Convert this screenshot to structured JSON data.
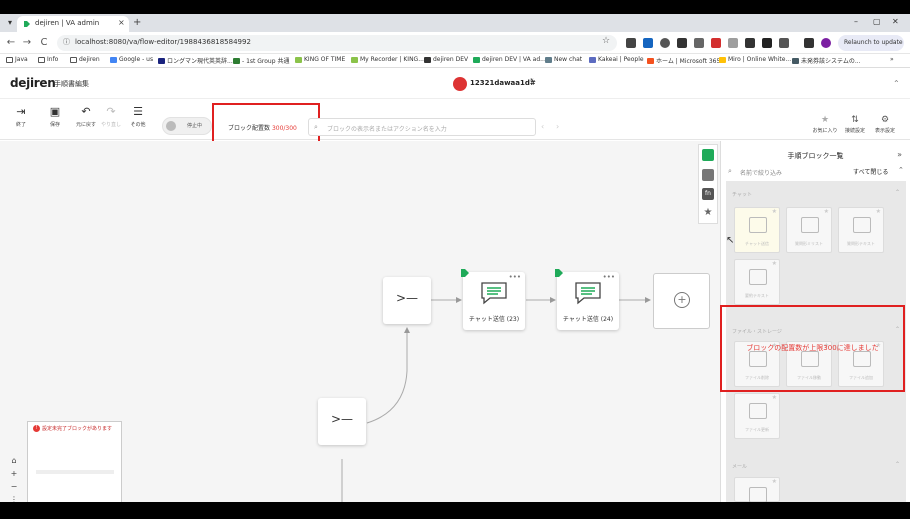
{
  "browser": {
    "tab": {
      "title": "dejiren | VA admin",
      "close": "×"
    },
    "new_tab": "+",
    "window_controls": [
      "–",
      "▢",
      "✕"
    ],
    "nav": {
      "back": "←",
      "forward": "→",
      "reload": "C"
    },
    "url": "localhost:8080/va/flow-editor/1988436818584992",
    "relaunch": "Relaunch to update",
    "bookmarks": [
      "Java",
      "Info",
      "dejiren",
      "Google - us",
      "ロングマン現代英英辞...",
      "- 1st Group 共通",
      "KING OF TIME",
      "My Recorder | KING...",
      "dejiren DEV",
      "dejiren DEV | VA ad...",
      "New chat",
      "Kakeai | People",
      "ホーム | Microsoft 365",
      "Miro | Online White...",
      "未発券該システムの..."
    ]
  },
  "app": {
    "logo": "dejiren",
    "page_title": "手順書編集",
    "flow_name": "12321dawaa1d#",
    "flow_mark": "*"
  },
  "toolbar": {
    "tools": [
      {
        "label": "終了",
        "icon": "⇥"
      },
      {
        "label": "保存",
        "icon": "▣"
      },
      {
        "label": "元に戻す",
        "icon": "↶"
      },
      {
        "label": "やり直し",
        "icon": "↷"
      },
      {
        "label": "その他",
        "icon": "☰"
      }
    ],
    "toggle_label": "停止中",
    "block_count_label": "ブロック配置数",
    "block_count_value": "300/300",
    "action_search_placeholder": "ブロックの表示名またはアクション名を入力",
    "right_tools": [
      {
        "label": "お気に入り",
        "icon": "★"
      },
      {
        "label": "接続設定",
        "icon": "⇅"
      },
      {
        "label": "表示設定",
        "icon": "⚙"
      }
    ]
  },
  "canvas": {
    "nodes": [
      {
        "label": "チャット送信 (23)"
      },
      {
        "label": "チャット送信 (24)"
      }
    ],
    "add_icon": "+",
    "warning_title": "設定未完了ブロックがあります",
    "zoom": [
      "⌂",
      "+",
      "−",
      "⋮"
    ]
  },
  "panel": {
    "title": "手順ブロック一覧",
    "search_placeholder": "名前で絞り込み",
    "close_all": "すべて閉じる",
    "sections": [
      {
        "title": "チャット",
        "cards": [
          "チャット送信",
          "質問形ミリスト",
          "質問形テキスト",
          "要約テキスト"
        ]
      },
      {
        "title": "ファイル・ストレージ",
        "cards": [
          "ファイル削除",
          "ファイル移動",
          "ファイル追加",
          "ファイル更新"
        ]
      },
      {
        "title": "メール",
        "cards": [
          ""
        ]
      }
    ],
    "limit_warning": "ブロックの配置数が上限300に達しました",
    "strip_icons": [
      "cube-icon",
      "puzzle-icon",
      "fn",
      "star-icon"
    ]
  },
  "colors": {
    "accent_red": "#e53935",
    "highlight_red": "#e02020",
    "brand_green": "#1faa59"
  }
}
